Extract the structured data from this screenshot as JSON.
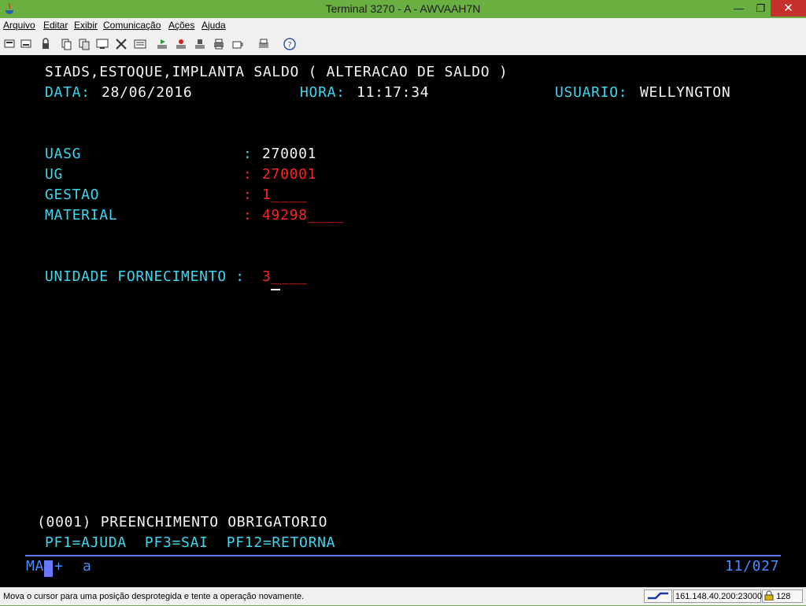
{
  "window": {
    "title": "Terminal 3270 - A - AWVAAH7N",
    "minimize": "—",
    "maximize": "❐",
    "close": "✕"
  },
  "menu": [
    "Arquivo",
    "Editar",
    "Exibir",
    "Comunicação",
    "Ações",
    "Ajuda"
  ],
  "toolbar": [
    "copy-icon",
    "paste-icon",
    "lock-icon",
    "cut-icon",
    "copy2-icon",
    "screen-icon",
    "macro-icon",
    "keyboard-icon",
    "play-icon",
    "record-icon",
    "stop-icon",
    "printer-icon",
    "coffee-icon",
    "print-screen-icon",
    "help-icon"
  ],
  "screen": {
    "header": "SIADS,ESTOQUE,IMPLANTA SALDO ( ALTERACAO DE SALDO )",
    "date_label": "DATA:",
    "date_value": "28/06/2016",
    "time_label": "HORA:",
    "time_value": "11:17:34",
    "user_label": "USUARIO:",
    "user_value": "WELLYNGTON",
    "fields": [
      {
        "label": "UASG",
        "sep": ":",
        "value": "270001",
        "pad": ""
      },
      {
        "label": "UG",
        "sep": ":",
        "value": "270001",
        "pad": ""
      },
      {
        "label": "GESTAO",
        "sep": ":",
        "value": "1",
        "pad": "____"
      },
      {
        "label": "MATERIAL",
        "sep": ":",
        "value": "49298",
        "pad": "____"
      }
    ],
    "unidade_label": "UNIDADE FORNECIMENTO :",
    "unidade_value": "3",
    "unidade_pad": "____",
    "message": "(0001) PREENCHIMENTO OBRIGATORIO",
    "pf_keys": "PF1=AJUDA  PF3=SAI  PF12=RETORNA"
  },
  "oia": {
    "left": "MA",
    "mid": "+",
    "char": "a",
    "cursor_pos": "11/027"
  },
  "status": {
    "message": "Mova o cursor para uma posição desprotegida e tente a operação novamente.",
    "connection_icon": "connection-icon",
    "host": "161.148.40.200:23000",
    "lock_icon": "lock-icon",
    "encryption": "128"
  },
  "colors": {
    "bg": "#000000",
    "field": "#3cd6ee",
    "protected": "#f4f4f4",
    "input": "#ff2424",
    "oia": "#6a78ff",
    "title_bar": "#6ab041"
  }
}
